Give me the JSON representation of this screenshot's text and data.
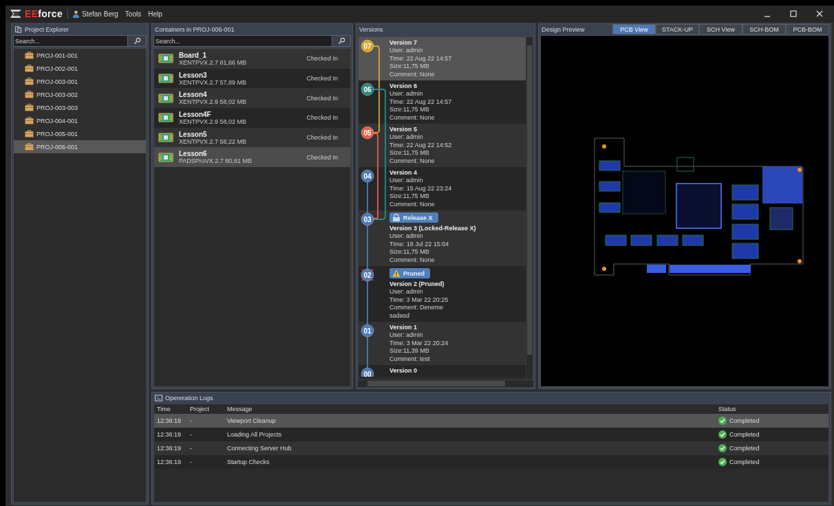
{
  "app": {
    "logo_accent": "EE",
    "logo_rest": "force"
  },
  "menu": [
    {
      "kind": "user",
      "label": "Stefan Berg"
    },
    {
      "kind": "plain",
      "label": "Tools"
    },
    {
      "kind": "plain",
      "label": "Help"
    }
  ],
  "project_explorer": {
    "title": "Project Explorer",
    "search": {
      "placeholder": "Search..."
    },
    "items": [
      {
        "label": "PROJ-001-001",
        "selected": false
      },
      {
        "label": "PROJ-002-001",
        "selected": false
      },
      {
        "label": "PROJ-003-001",
        "selected": false
      },
      {
        "label": "PROJ-003-002",
        "selected": false
      },
      {
        "label": "PROJ-003-003",
        "selected": false
      },
      {
        "label": "PROJ-004-001",
        "selected": false
      },
      {
        "label": "PROJ-005-001",
        "selected": false
      },
      {
        "label": "PROJ-006-001",
        "selected": true
      }
    ]
  },
  "containers": {
    "title": "Containers in PROJ-006-001",
    "search": {
      "placeholder": "Search..."
    },
    "items": [
      {
        "name": "Board_1",
        "info": "XENTPVX.2.7 81,66 MB",
        "status": "Checked In",
        "selected": false
      },
      {
        "name": "Lesson3",
        "info": "XENTPVX.2.7 57,89 MB",
        "status": "Checked In",
        "selected": false
      },
      {
        "name": "Lesson4",
        "info": "XENTPVX.2.9 58,02 MB",
        "status": "Checked In",
        "selected": false
      },
      {
        "name": "Lesson4F",
        "info": "XENTPVX.2.9 58,02 MB",
        "status": "Checked In",
        "selected": false
      },
      {
        "name": "Lesson5",
        "info": "XENTPVX.2.7 58,22 MB",
        "status": "Checked In",
        "selected": false
      },
      {
        "name": "Lesson6",
        "info": "PADSProVX.2.7 80,61 MB",
        "status": "Checked In",
        "selected": true
      }
    ]
  },
  "versions": {
    "title": "Versions",
    "items": [
      {
        "number": "07",
        "color": "#d9a62e",
        "pruned": false,
        "selected": true,
        "title": "Version 7",
        "details": [
          "User: admin",
          "Time: 22 Aug 22 14:57",
          "Size:11,75 MB",
          "Comment: None"
        ]
      },
      {
        "number": "06",
        "color": "#2a8a80",
        "pruned": false,
        "selected": false,
        "title": "Version 6",
        "details": [
          "User: admin",
          "Time: 22 Aug 22 14:57",
          "Size:11,75 MB",
          "Comment: None"
        ]
      },
      {
        "number": "05",
        "color": "#e8604a",
        "pruned": false,
        "selected": false,
        "title": "Version 5",
        "details": [
          "User: admin",
          "Time: 22 Aug 22 14:52",
          "Size:11,75 MB",
          "Comment: None"
        ]
      },
      {
        "number": "04",
        "color": "#4a7ab8",
        "pruned": false,
        "selected": false,
        "title": "Version 4",
        "details": [
          "User: admin",
          "Time: 15 Aug 22 23:24",
          "Size:11,75 MB",
          "Comment: None"
        ]
      },
      {
        "number": "03",
        "color": "#4a7ab8",
        "pruned": false,
        "selected": false,
        "tag": {
          "kind": "release",
          "label": "Release X"
        },
        "title": "Version 3 (Locked-Release X)",
        "details": [
          "User: admin",
          "Time: 18 Jul 22 15:04",
          "Size:11,75 MB",
          "Comment: None"
        ]
      },
      {
        "number": "02",
        "color": "#4a7ab8",
        "pruned": true,
        "selected": false,
        "tag": {
          "kind": "warning",
          "label": "Pruned"
        },
        "title": "Version 2 (Pruned)",
        "details": [
          "User: admin",
          "Time: 3 Mar 22 20:25",
          "Comment: Deneme",
          "sadasd"
        ]
      },
      {
        "number": "01",
        "color": "#4a7ab8",
        "pruned": false,
        "selected": false,
        "title": "Version 1",
        "details": [
          "User: admin",
          "Time: 3 Mar 22 20:24",
          "Size:11,39 MB",
          "Comment: test"
        ]
      },
      {
        "number": "00",
        "color": "#4a7ab8",
        "pruned": false,
        "selected": false,
        "title": "Version 0"
      }
    ]
  },
  "design_preview": {
    "title": "Design Preview",
    "tabs": [
      {
        "label": "PCB View",
        "selected": true
      },
      {
        "label": "STACK-UP",
        "selected": false
      },
      {
        "label": "SCH View",
        "selected": false
      },
      {
        "label": "SCH-BOM",
        "selected": false
      },
      {
        "label": "PCB-BOM",
        "selected": false
      }
    ]
  },
  "logs": {
    "title": "Opereration Logs",
    "columns": [
      "Time",
      "Project",
      "Message",
      "Status"
    ],
    "rows": [
      {
        "time": "12:36:19",
        "project": "-",
        "message": "Viewport Cleanup",
        "status": "Completed",
        "kind": "success",
        "selected": true
      },
      {
        "time": "12:36:19",
        "project": "-",
        "message": "Loading All Projects",
        "status": "Completed",
        "kind": "success",
        "selected": false
      },
      {
        "time": "12:36:19",
        "project": "-",
        "message": "Connecting Server Hub",
        "status": "Completed",
        "kind": "success",
        "selected": false
      },
      {
        "time": "12:36:19",
        "project": "-",
        "message": "Startup Checks",
        "status": "Completed",
        "kind": "success",
        "selected": false
      }
    ]
  }
}
